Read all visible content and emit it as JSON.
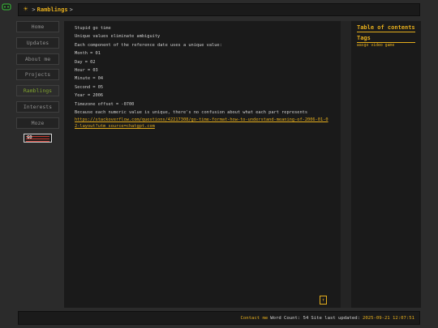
{
  "breadcrumb": {
    "separator": ">",
    "current": "Ramblings",
    "trailing": ">"
  },
  "nav": [
    {
      "label": "Home"
    },
    {
      "label": "Updates"
    },
    {
      "label": "About me"
    },
    {
      "label": "Projects"
    },
    {
      "label": "Ramblings",
      "active": true
    },
    {
      "label": "Interests"
    },
    {
      "label": "Moze"
    }
  ],
  "badge": {
    "text": "GO"
  },
  "article": {
    "lines": [
      "Stupid go time",
      "Unique values eliminate ambiguity",
      "Each component of the reference date uses a unique value:",
      "Month = 01",
      "Day = 02",
      "Hour = 03",
      "Minute = 04",
      "Second = 05",
      "Year = 2006",
      "Timezone offset = -0700",
      "Because each numeric value is unique, there's no confusion about what each part represents"
    ],
    "link": "https://stackoverflow.com/questions/42217308/go-time-format-how-to-understand-meaning-of-2006-01-02-layout?utm_source=chatgpt.com"
  },
  "scroll_top": {
    "label": "↑"
  },
  "toc": {
    "title": "Table of contents",
    "tags_title": "Tags",
    "tags": "wasgo video game"
  },
  "footer": {
    "contact": "Contact me",
    "word_count": "Word Count: 54",
    "updated_label": "Site last updated:",
    "updated_value": "2025-09-21 12:07:51"
  },
  "colors": {
    "accent": "#e4ad1d",
    "active_nav": "#7fa22e",
    "background": "#2b2b2b",
    "panel": "#1a1a1a"
  }
}
